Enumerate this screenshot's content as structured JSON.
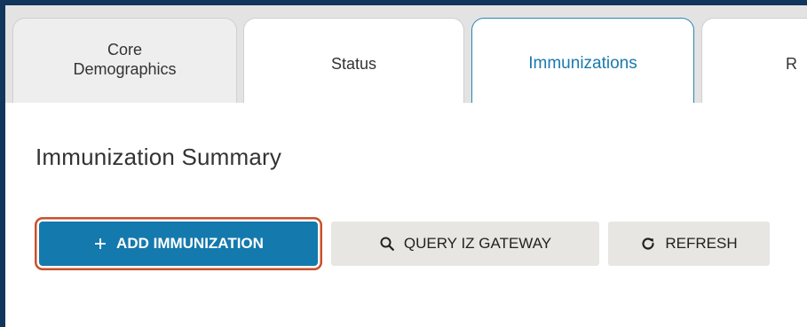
{
  "tabs": [
    {
      "label_line1": "Core",
      "label_line2": "Demographics"
    },
    {
      "label": "Status"
    },
    {
      "label": "Immunizations"
    },
    {
      "label": "R"
    }
  ],
  "page_title": "Immunization Summary",
  "buttons": {
    "add": {
      "icon": "plus-icon",
      "label": "ADD IMMUNIZATION"
    },
    "query": {
      "icon": "search-icon",
      "label": "QUERY IZ GATEWAY"
    },
    "refresh": {
      "icon": "refresh-icon",
      "label": "REFRESH"
    }
  },
  "colors": {
    "frame": "#12355b",
    "accent": "#1479ad",
    "highlight": "#c8502a",
    "secondary_button": "#e8e6e3"
  }
}
